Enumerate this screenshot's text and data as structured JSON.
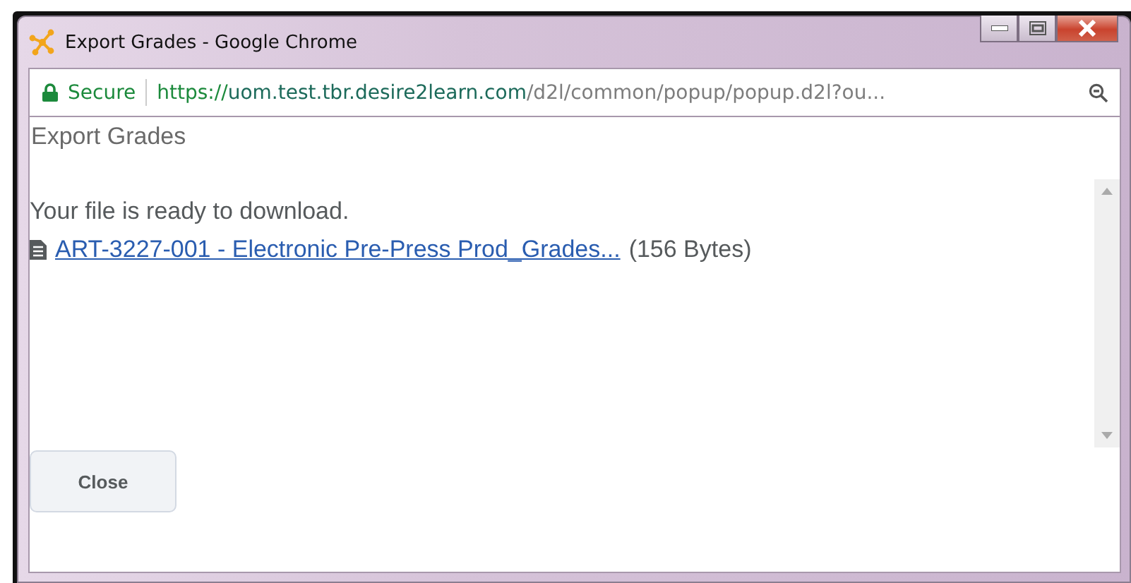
{
  "window": {
    "title": "Export Grades - Google Chrome",
    "controls": [
      {
        "kind": "minimize"
      },
      {
        "kind": "maximize"
      },
      {
        "kind": "close"
      }
    ]
  },
  "address_bar": {
    "security_label": "Secure",
    "url": {
      "scheme": "https://",
      "host": "uom.test.tbr.desire2learn.com",
      "path": "/d2l/common/popup/popup.d2l?ou..."
    }
  },
  "page": {
    "heading": "Export Grades",
    "message": "Your file is ready to download.",
    "file": {
      "link": "ART-3227-001 - Electronic Pre-Press Prod_Grades...",
      "size": "(156 Bytes)"
    },
    "buttons": [
      "Close"
    ]
  }
}
